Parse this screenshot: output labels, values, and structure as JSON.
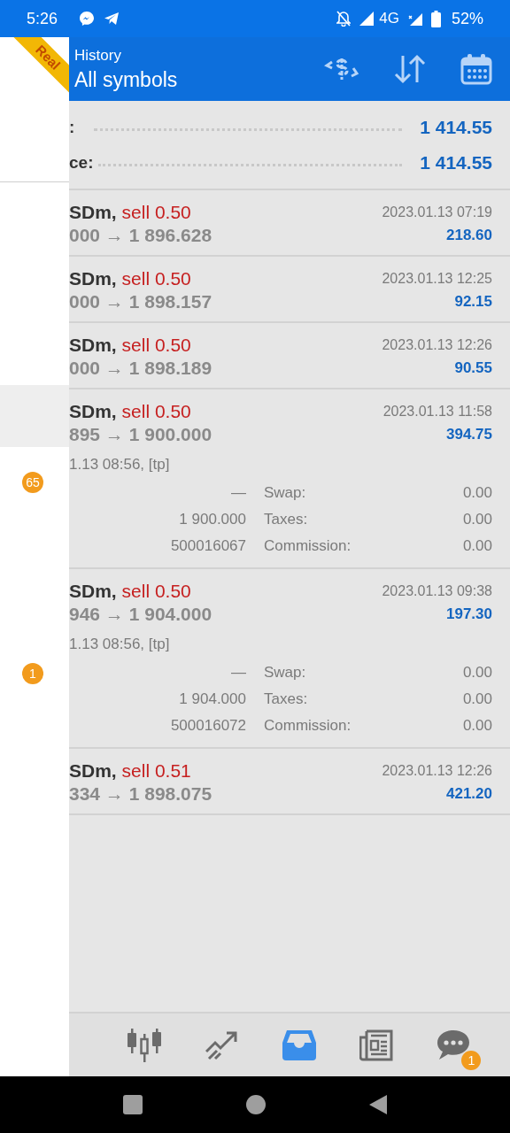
{
  "status_bar": {
    "time": "5:26",
    "network": "4G",
    "battery": "52%"
  },
  "drawer": {
    "ribbon": "Real",
    "items": [
      {
        "kind": "highlight"
      },
      {
        "kind": "badge",
        "badge": "65"
      },
      {
        "kind": "badge",
        "badge": "1"
      }
    ]
  },
  "header": {
    "title": "History",
    "subtitle": "All symbols"
  },
  "summary": [
    {
      "label": ":",
      "value": "1 414.55"
    },
    {
      "label": "ce:",
      "value": "1 414.55"
    }
  ],
  "deals": [
    {
      "symbol": "SDm,",
      "action": "sell 0.50",
      "prices": "000 → 1 896.628",
      "time": "2023.01.13 07:19",
      "profit": "218.60"
    },
    {
      "symbol": "SDm,",
      "action": "sell 0.50",
      "prices": "000 → 1 898.157",
      "time": "2023.01.13 12:25",
      "profit": "92.15"
    },
    {
      "symbol": "SDm,",
      "action": "sell 0.50",
      "prices": "000 → 1 898.189",
      "time": "2023.01.13 12:26",
      "profit": "90.55"
    },
    {
      "symbol": "SDm,",
      "action": "sell 0.50",
      "prices": "895 → 1 900.000",
      "time": "2023.01.13 11:58",
      "profit": "394.75",
      "open_info": "1.13 08:56, [tp]",
      "details": [
        {
          "value": "—",
          "label": "Swap:",
          "amount": "0.00"
        },
        {
          "value": "1 900.000",
          "label": "Taxes:",
          "amount": "0.00"
        },
        {
          "value": "500016067",
          "label": "Commission:",
          "amount": "0.00"
        }
      ]
    },
    {
      "symbol": "SDm,",
      "action": "sell 0.50",
      "prices": "946 → 1 904.000",
      "time": "2023.01.13 09:38",
      "profit": "197.30",
      "open_info": "1.13 08:56, [tp]",
      "details": [
        {
          "value": "—",
          "label": "Swap:",
          "amount": "0.00"
        },
        {
          "value": "1 904.000",
          "label": "Taxes:",
          "amount": "0.00"
        },
        {
          "value": "500016072",
          "label": "Commission:",
          "amount": "0.00"
        }
      ]
    },
    {
      "symbol": "SDm,",
      "action": "sell 0.51",
      "prices": "334 → 1 898.075",
      "time": "2023.01.13 12:26",
      "profit": "421.20"
    }
  ],
  "bottom_nav": [
    {
      "kind": "quotes",
      "selected": false
    },
    {
      "kind": "trade",
      "selected": false
    },
    {
      "kind": "history",
      "selected": true
    },
    {
      "kind": "news",
      "selected": false
    },
    {
      "kind": "chat",
      "selected": false,
      "badge": "1"
    }
  ]
}
